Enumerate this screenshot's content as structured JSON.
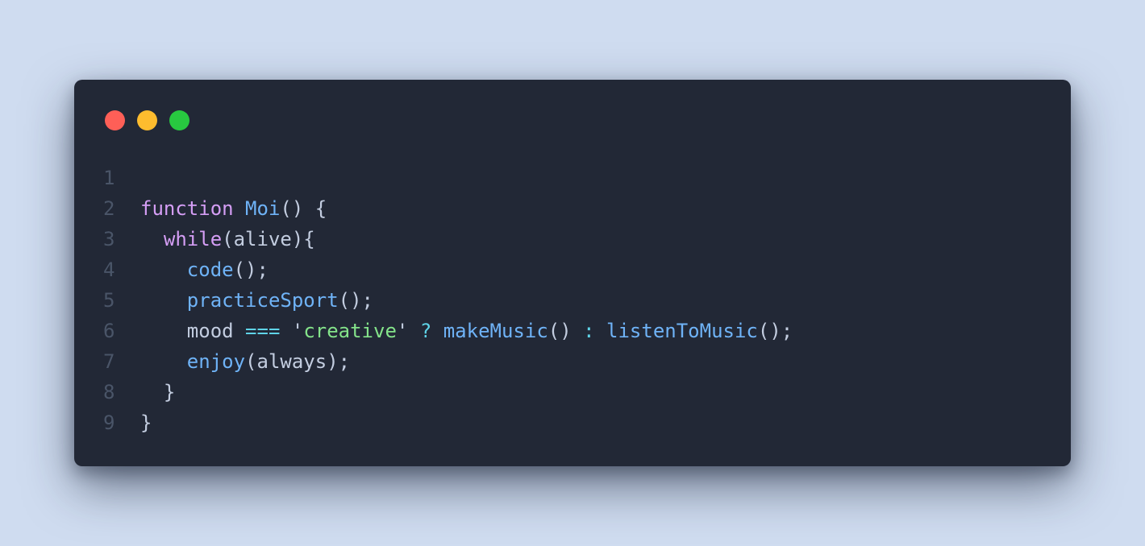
{
  "colors": {
    "background": "#cfdcf0",
    "editor_bg": "#222836",
    "line_number": "#4a5568",
    "default": "#c3cde0",
    "keyword": "#d59ef5",
    "function": "#6fb3f7",
    "string": "#84e38a",
    "operator": "#5fd4e8",
    "close_btn": "#fe5f57",
    "minimize_btn": "#febc2e",
    "maximize_btn": "#28c840"
  },
  "window_controls": [
    "close-icon",
    "minimize-icon",
    "maximize-icon"
  ],
  "lines": [
    {
      "number": "1",
      "tokens": []
    },
    {
      "number": "2",
      "tokens": [
        {
          "t": "function",
          "k": "keyword"
        },
        {
          "t": " ",
          "k": "default"
        },
        {
          "t": "Moi",
          "k": "function"
        },
        {
          "t": "() {",
          "k": "default"
        }
      ]
    },
    {
      "number": "3",
      "tokens": [
        {
          "t": "  ",
          "k": "default"
        },
        {
          "t": "while",
          "k": "keyword"
        },
        {
          "t": "(alive){",
          "k": "default"
        }
      ]
    },
    {
      "number": "4",
      "tokens": [
        {
          "t": "    ",
          "k": "default"
        },
        {
          "t": "code",
          "k": "function"
        },
        {
          "t": "();",
          "k": "default"
        }
      ]
    },
    {
      "number": "5",
      "tokens": [
        {
          "t": "    ",
          "k": "default"
        },
        {
          "t": "practiceSport",
          "k": "function"
        },
        {
          "t": "();",
          "k": "default"
        }
      ]
    },
    {
      "number": "6",
      "tokens": [
        {
          "t": "    mood ",
          "k": "default"
        },
        {
          "t": "===",
          "k": "operator"
        },
        {
          "t": " '",
          "k": "default"
        },
        {
          "t": "creative",
          "k": "string"
        },
        {
          "t": "' ",
          "k": "default"
        },
        {
          "t": "?",
          "k": "operator"
        },
        {
          "t": " ",
          "k": "default"
        },
        {
          "t": "makeMusic",
          "k": "function"
        },
        {
          "t": "() ",
          "k": "default"
        },
        {
          "t": ":",
          "k": "operator"
        },
        {
          "t": " ",
          "k": "default"
        },
        {
          "t": "listenToMusic",
          "k": "function"
        },
        {
          "t": "();",
          "k": "default"
        }
      ]
    },
    {
      "number": "7",
      "tokens": [
        {
          "t": "    ",
          "k": "default"
        },
        {
          "t": "enjoy",
          "k": "function"
        },
        {
          "t": "(always);",
          "k": "default"
        }
      ]
    },
    {
      "number": "8",
      "tokens": [
        {
          "t": "  }",
          "k": "default"
        }
      ]
    },
    {
      "number": "9",
      "tokens": [
        {
          "t": "}",
          "k": "default"
        }
      ]
    }
  ]
}
